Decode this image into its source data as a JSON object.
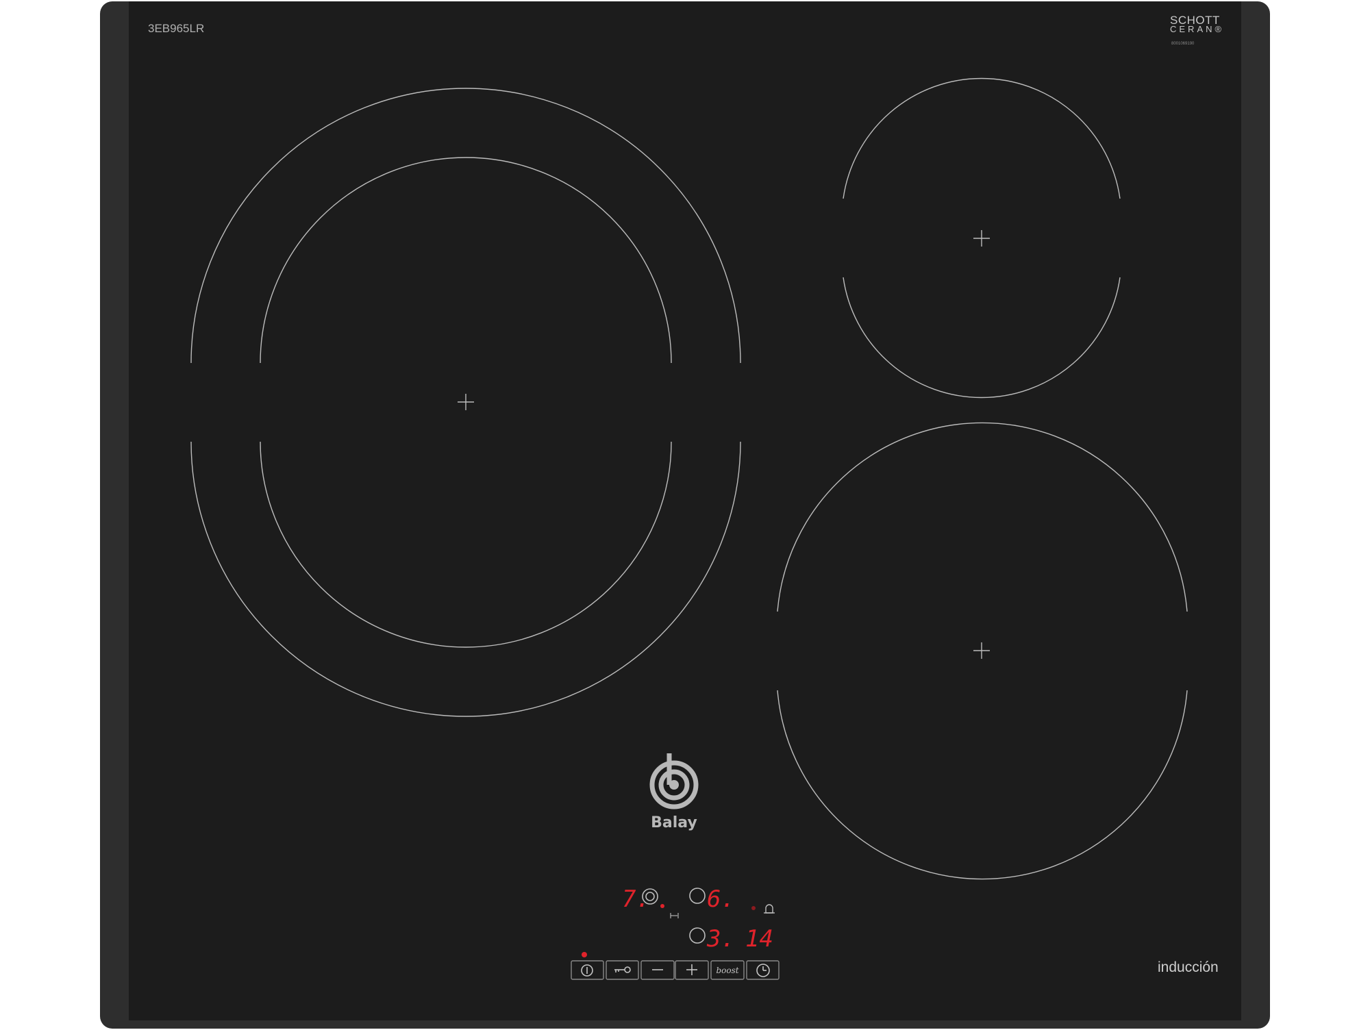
{
  "appliance": {
    "model": "3EB965LR",
    "glass_brand_line1": "SCHOTT",
    "glass_brand_line2": "CERAN®",
    "glass_code": "8001069190",
    "brand": "Balay",
    "type_label": "inducción"
  },
  "display": {
    "left_zone_level": "7.",
    "right_top_level": "6.",
    "right_bottom_level": "3.",
    "timer_value": "14"
  },
  "controls": {
    "power_icon": "power-icon",
    "lock_icon": "key-lock-icon",
    "minus_icon": "minus-icon",
    "plus_icon": "plus-icon",
    "boost_label": "boost",
    "timer_icon": "clock-icon"
  },
  "colors": {
    "glass": "#1c1c1c",
    "frame": "#2e2e2e",
    "zone_line": "#bdbdbd",
    "led_red": "#e0232b"
  }
}
